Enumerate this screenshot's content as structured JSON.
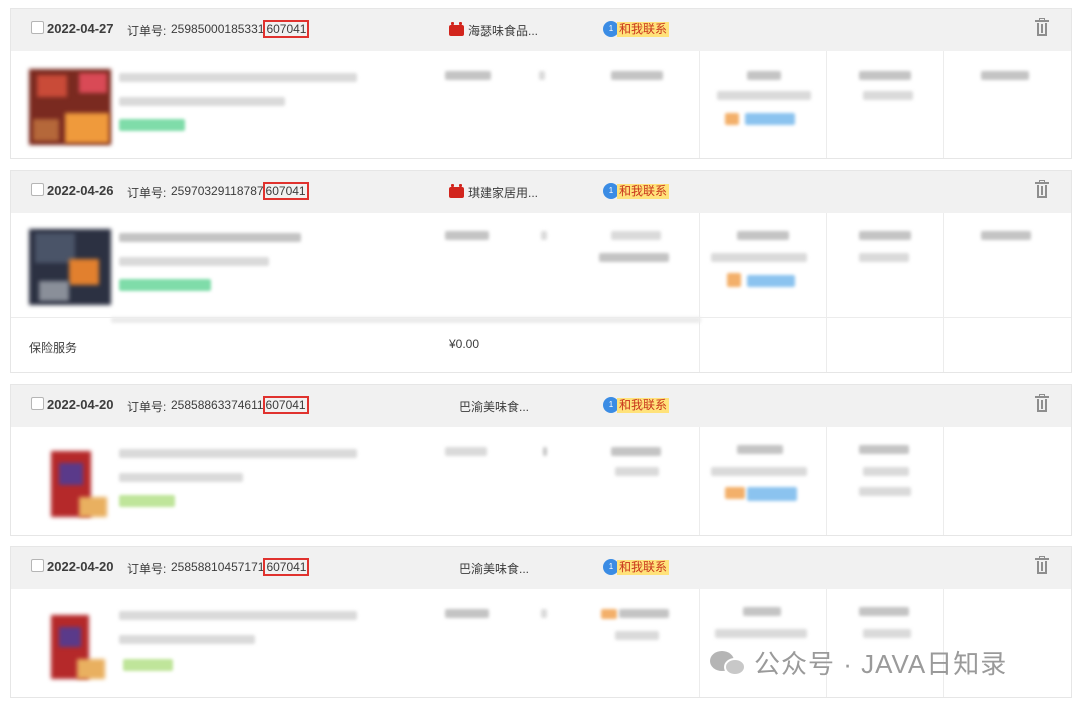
{
  "colors": {
    "header_bg": "#f1f1f1",
    "highlight_box": "#e0322e",
    "contact_bg": "#ffe27a",
    "contact_text": "#c8341b",
    "tmall_badge": "#d2251d"
  },
  "common": {
    "order_no_label": "订单号:",
    "contact_label": "和我联系",
    "contact_icon": "chat-bubble-icon",
    "delete_icon": "trash-icon",
    "tmall_icon": "tmall-badge-icon"
  },
  "orders": [
    {
      "date": "2022-04-27",
      "order_prefix": "25985000185331",
      "order_suffix": "607041",
      "shop": "海瑟味食品...",
      "tmall": true
    },
    {
      "date": "2022-04-26",
      "order_prefix": "25970329118787",
      "order_suffix": "607041",
      "shop": "琪建家居用...",
      "tmall": true,
      "insurance_label": "保险服务",
      "insurance_price": "¥0.00"
    },
    {
      "date": "2022-04-20",
      "order_prefix": "25858863374611",
      "order_suffix": "607041",
      "shop": "巴渝美味食...",
      "tmall": false
    },
    {
      "date": "2022-04-20",
      "order_prefix": "25858810457171",
      "order_suffix": "607041",
      "shop": "巴渝美味食...",
      "tmall": false
    }
  ],
  "watermark": {
    "text": "公众号 · JAVA日知录",
    "icon": "wechat-icon"
  }
}
